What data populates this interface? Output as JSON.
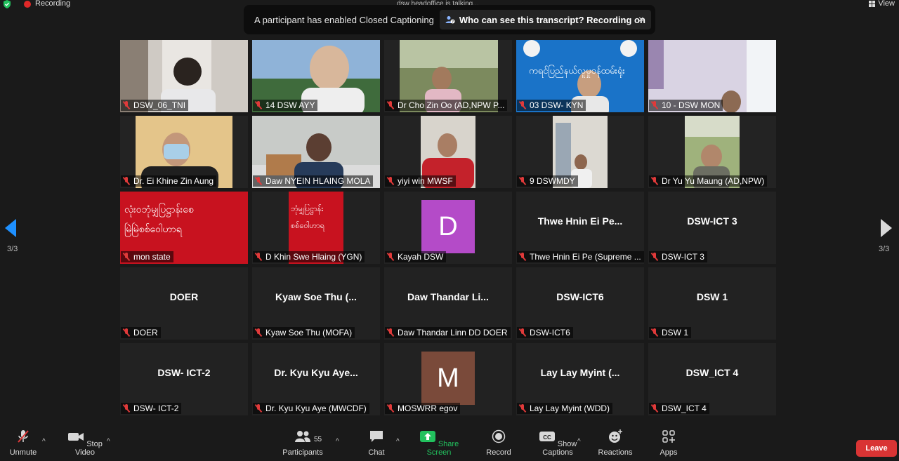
{
  "top": {
    "recording": "Recording",
    "view": "View",
    "talking": "dsw headoffice is talking..."
  },
  "banner": {
    "text": "A participant has enabled Closed Captioning",
    "link": "Who can see this transcript? Recording on",
    "close": "×"
  },
  "page": {
    "left": "3/3",
    "right": "3/3"
  },
  "tiles": [
    {
      "label": "DSW_06_TNI"
    },
    {
      "label": "14 DSW AYY"
    },
    {
      "label": "Dr Cho Zin Oo (AD,NPW P..."
    },
    {
      "label": "03 DSW- KYN",
      "banner_text": "ကရင်ပြည်နယ်လူမှုဝန်ထမ်းရုံး"
    },
    {
      "label": "10 - DSW MON"
    },
    {
      "label": "Dr. Ei Khine Zin Aung"
    },
    {
      "label": "Daw NYEIN HLAING  MOLA"
    },
    {
      "label": "yiyi win MWSF"
    },
    {
      "label": "9 DSWMDY"
    },
    {
      "label": "Dr Yu Yu Maung (AD,NPW)"
    },
    {
      "label": "mon state",
      "line1": "လုံးဝဘုံမျှပြဋ္ဌာန်းစေ",
      "line2": "မြဲမြဲစစ်ဝေါဟာရ"
    },
    {
      "label": "D Khin Swe Hlaing (YGN)",
      "line1": "ဘုံမျှပြဋ္ဌာန်း",
      "line2": "စစ်ဝေါဟာရ"
    },
    {
      "label": "Kayah DSW",
      "avatar": "D"
    },
    {
      "label": "Thwe Hnin Ei Pe (Supreme ...",
      "bigname": "Thwe Hnin Ei Pe..."
    },
    {
      "label": "DSW-ICT 3",
      "bigname": "DSW-ICT 3"
    },
    {
      "label": "DOER",
      "bigname": "DOER"
    },
    {
      "label": "Kyaw Soe Thu (MOFA)",
      "bigname": "Kyaw Soe Thu (..."
    },
    {
      "label": "Daw Thandar Linn DD DOER",
      "bigname": "Daw Thandar Li..."
    },
    {
      "label": "DSW-ICT6",
      "bigname": "DSW-ICT6"
    },
    {
      "label": "DSW 1",
      "bigname": "DSW 1"
    },
    {
      "label": "DSW- ICT-2",
      "bigname": "DSW- ICT-2"
    },
    {
      "label": "Dr. Kyu Kyu Aye (MWCDF)",
      "bigname": "Dr. Kyu Kyu Aye..."
    },
    {
      "label": "MOSWRR egov",
      "avatar": "M"
    },
    {
      "label": "Lay Lay Myint (WDD)",
      "bigname": "Lay Lay Myint (..."
    },
    {
      "label": "DSW_ICT 4",
      "bigname": "DSW_ICT 4"
    }
  ],
  "toolbar": {
    "unmute": "Unmute",
    "stop_video": "Stop Video",
    "participants": "Participants",
    "participants_count": "55",
    "chat": "Chat",
    "share": "Share Screen",
    "record": "Record",
    "captions": "Show Captions",
    "reactions": "Reactions",
    "apps": "Apps",
    "leave": "Leave"
  },
  "colors": {
    "accent_green": "#22c15e",
    "leave_red": "#d93434",
    "avatar_d": "#b44bc8",
    "avatar_m": "#7a4a3a",
    "red_banner": "#c8121f"
  }
}
